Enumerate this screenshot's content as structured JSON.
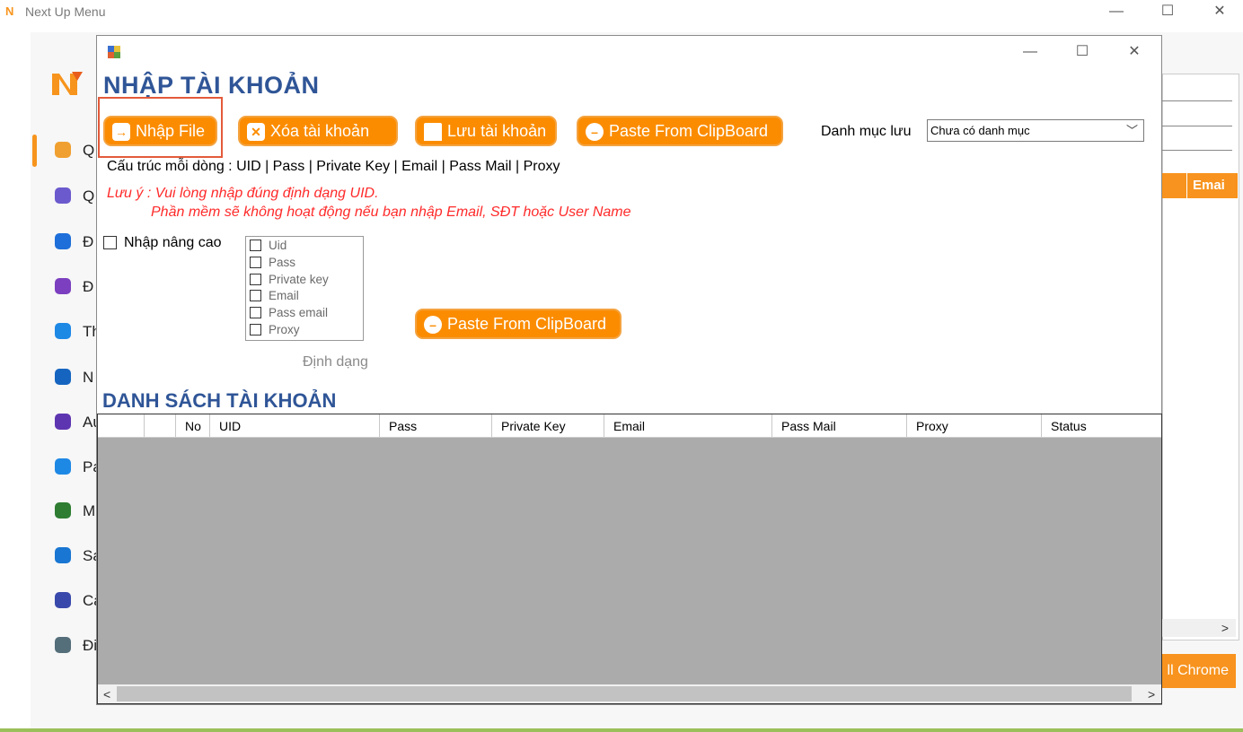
{
  "outer_window": {
    "title": "Next Up Menu",
    "minimize": "—",
    "maximize": "☐",
    "close": "✕"
  },
  "app_sidebar": {
    "items": [
      {
        "icon": "user-manage-icon",
        "text": "Q"
      },
      {
        "icon": "database-icon",
        "text": "Q"
      },
      {
        "icon": "id-card-icon",
        "text": "Đ"
      },
      {
        "icon": "network-icon",
        "text": "Đ"
      },
      {
        "icon": "dots-icon",
        "text": "Th"
      },
      {
        "icon": "chat-icon",
        "text": "N"
      },
      {
        "icon": "quote-icon",
        "text": "Au"
      },
      {
        "icon": "upload-icon",
        "text": "Pa"
      },
      {
        "icon": "store-icon",
        "text": "M"
      },
      {
        "icon": "document-search-icon",
        "text": "Sa"
      },
      {
        "icon": "settings-gears-icon",
        "text": "Cà"
      },
      {
        "icon": "clipboard-icon",
        "text": "Đi"
      }
    ]
  },
  "background_right": {
    "column_header": "Emai",
    "scroll_right": ">",
    "chrome_button": "ll Chrome"
  },
  "dialog": {
    "minimize": "—",
    "maximize": "☐",
    "close": "✕",
    "title": "NHẬP TÀI KHOẢN",
    "buttons": {
      "import_file": "Nhập File",
      "delete_account": "Xóa tài khoản",
      "save_account": "Lưu tài khoản",
      "paste_clipboard": "Paste From ClipBoard"
    },
    "category_label": "Danh mục lưu",
    "category_value": "Chưa có danh mục",
    "structure_line": "Cấu trúc mỗi dòng : UID | Pass | Private Key | Email | Pass Mail | Proxy",
    "note_line1": "Lưu ý : Vui lòng nhập đúng định dạng UID.",
    "note_line2": "Phần mềm sẽ không hoạt động nếu bạn nhập Email, SĐT hoặc User Name",
    "advanced_label": "Nhập nâng cao",
    "fields": [
      "Uid",
      "Pass",
      "Private key",
      "Email",
      "Pass email",
      "Proxy"
    ],
    "paste_clipboard_2": "Paste From ClipBoard",
    "format_label": "Định dạng",
    "list_title": "DANH SÁCH TÀI KHOẢN",
    "grid_columns": [
      "",
      "",
      "No",
      "UID",
      "Pass",
      "Private Key",
      "Email",
      "Pass Mail",
      "Proxy",
      "Status"
    ],
    "scroll_left": "<",
    "scroll_right": ">"
  },
  "colors": {
    "accent_orange": "#fb8c00",
    "title_blue": "#2f5597",
    "warning_red": "#ff2a2a",
    "highlight_red": "#e35a3a"
  }
}
